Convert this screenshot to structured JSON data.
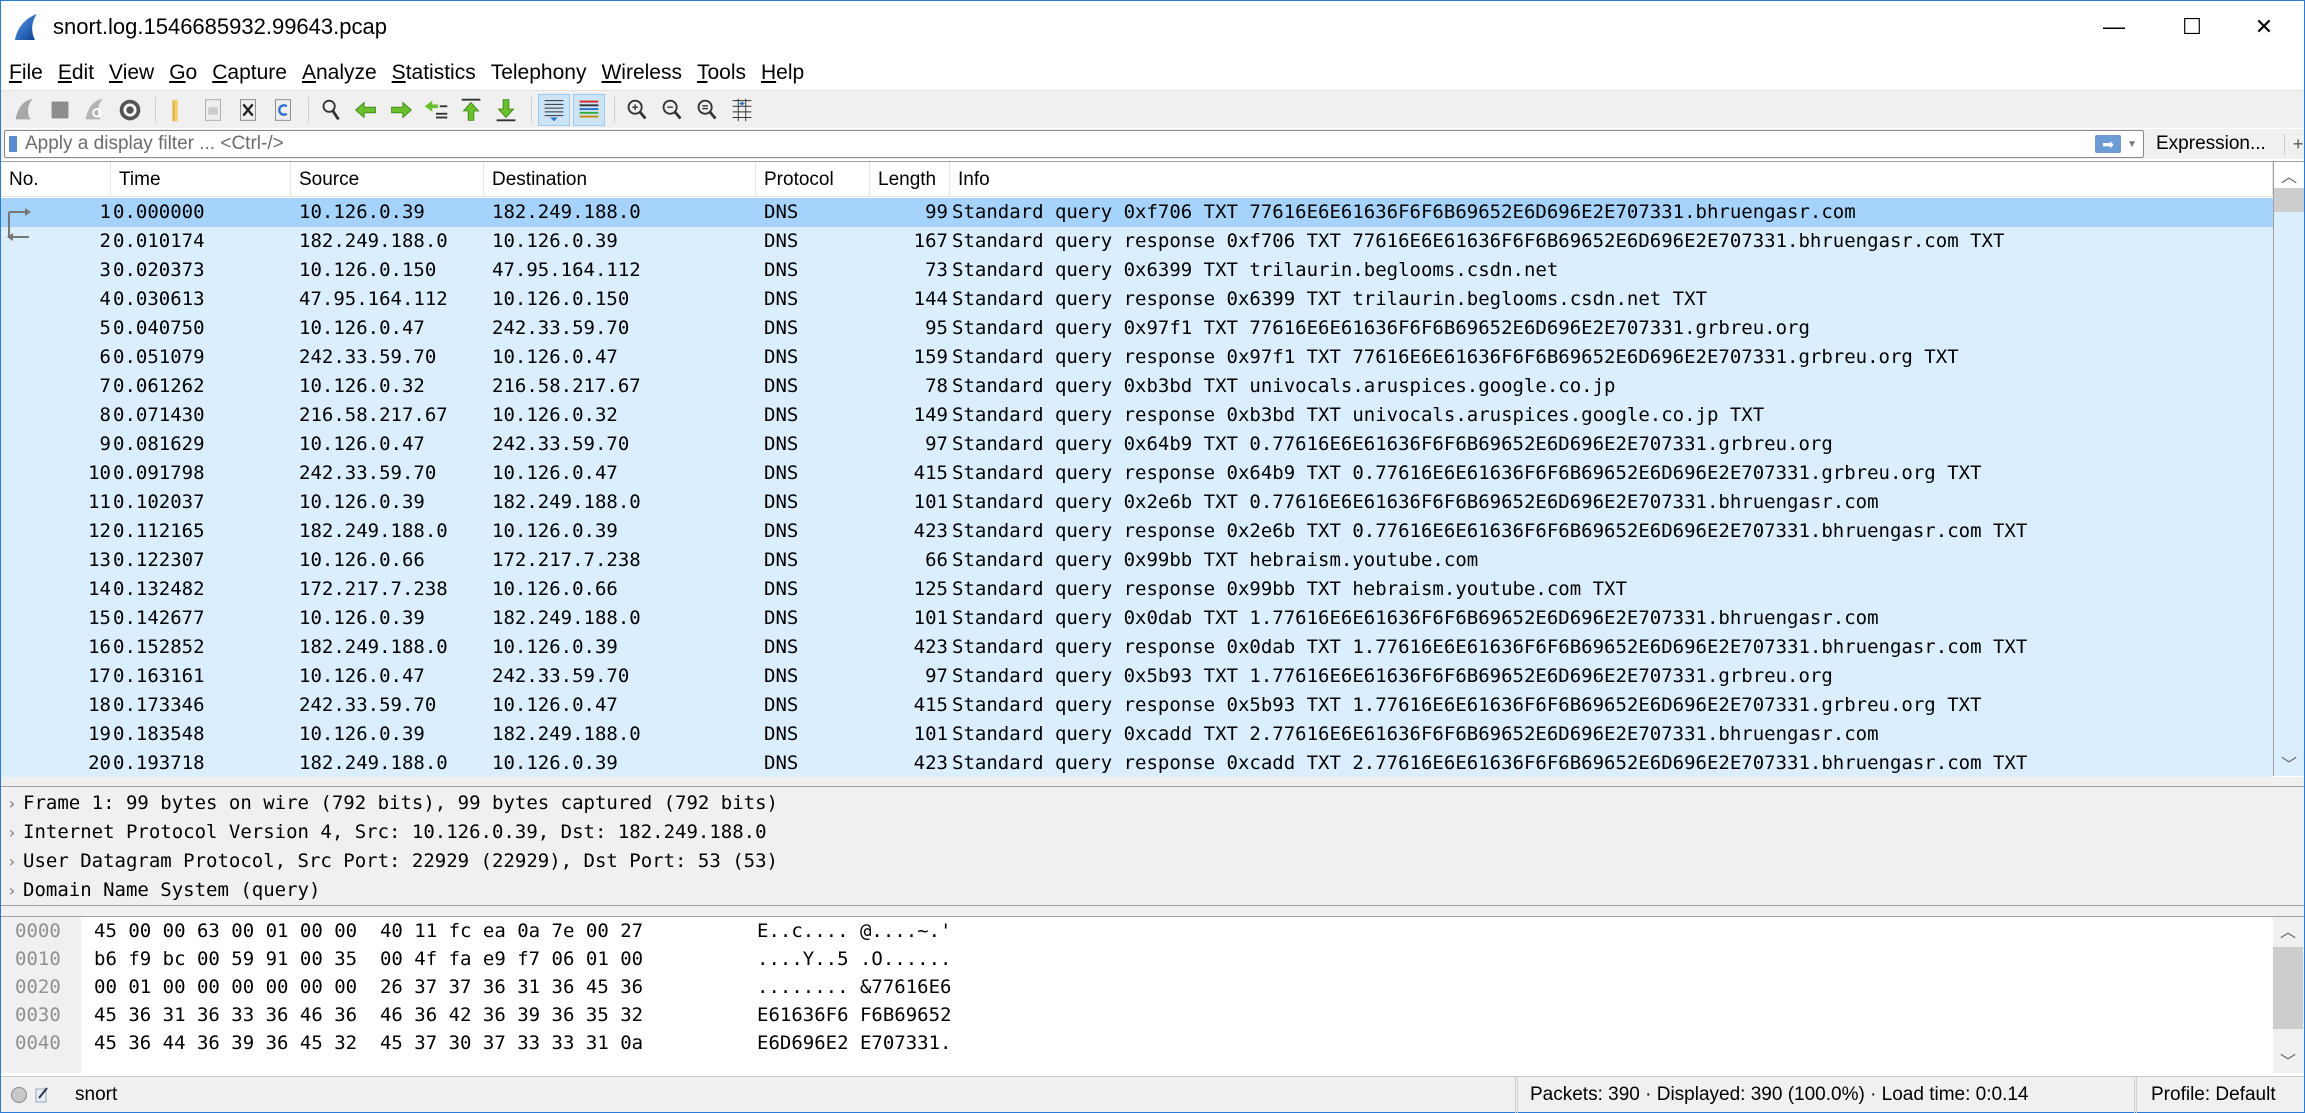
{
  "window": {
    "title": "snort.log.1546685932.99643.pcap",
    "controls": {
      "minimize": "—",
      "maximize": "☐",
      "close": "✕"
    }
  },
  "menu": [
    {
      "label": "File",
      "accel": "F",
      "rest": "ile"
    },
    {
      "label": "Edit",
      "accel": "E",
      "rest": "dit"
    },
    {
      "label": "View",
      "accel": "V",
      "rest": "iew"
    },
    {
      "label": "Go",
      "accel": "G",
      "rest": "o"
    },
    {
      "label": "Capture",
      "accel": "C",
      "rest": "apture"
    },
    {
      "label": "Analyze",
      "accel": "A",
      "rest": "nalyze"
    },
    {
      "label": "Statistics",
      "accel": "S",
      "rest": "tatistics"
    },
    {
      "label": "Telephony",
      "accel": "",
      "rest": "Telephony"
    },
    {
      "label": "Wireless",
      "accel": "W",
      "rest": "ireless"
    },
    {
      "label": "Tools",
      "accel": "T",
      "rest": "ools"
    },
    {
      "label": "Help",
      "accel": "H",
      "rest": "elp"
    }
  ],
  "toolbar": [
    {
      "name": "start-capture-icon"
    },
    {
      "name": "stop-capture-icon"
    },
    {
      "name": "restart-capture-icon"
    },
    {
      "name": "capture-options-icon"
    },
    {
      "name": "open-file-icon"
    },
    {
      "name": "save-file-icon"
    },
    {
      "name": "close-file-icon"
    },
    {
      "name": "reload-file-icon"
    },
    {
      "name": "find-packet-icon"
    },
    {
      "name": "go-back-icon"
    },
    {
      "name": "go-forward-icon"
    },
    {
      "name": "go-to-packet-icon"
    },
    {
      "name": "go-first-packet-icon"
    },
    {
      "name": "go-last-packet-icon"
    },
    {
      "name": "auto-scroll-icon",
      "active": true
    },
    {
      "name": "colorize-icon",
      "active": true
    },
    {
      "name": "zoom-in-icon"
    },
    {
      "name": "zoom-out-icon"
    },
    {
      "name": "zoom-normal-icon"
    },
    {
      "name": "resize-columns-icon"
    }
  ],
  "filter": {
    "placeholder": "Apply a display filter ... <Ctrl-/>",
    "value": "",
    "expression_label": "Expression...",
    "plus_label": "+"
  },
  "packet_list": {
    "columns": [
      "No.",
      "Time",
      "Source",
      "Destination",
      "Protocol",
      "Length",
      "Info"
    ],
    "selected_row": 1,
    "rows": [
      {
        "no": "1",
        "time": "0.000000",
        "src": "10.126.0.39",
        "dst": "182.249.188.0",
        "proto": "DNS",
        "len": "99",
        "info": "Standard query 0xf706 TXT 77616E6E61636F6F6B69652E6D696E2E707331.bhruengasr.com"
      },
      {
        "no": "2",
        "time": "0.010174",
        "src": "182.249.188.0",
        "dst": "10.126.0.39",
        "proto": "DNS",
        "len": "167",
        "info": "Standard query response 0xf706 TXT 77616E6E61636F6F6B69652E6D696E2E707331.bhruengasr.com TXT"
      },
      {
        "no": "3",
        "time": "0.020373",
        "src": "10.126.0.150",
        "dst": "47.95.164.112",
        "proto": "DNS",
        "len": "73",
        "info": "Standard query 0x6399 TXT trilaurin.beglooms.csdn.net"
      },
      {
        "no": "4",
        "time": "0.030613",
        "src": "47.95.164.112",
        "dst": "10.126.0.150",
        "proto": "DNS",
        "len": "144",
        "info": "Standard query response 0x6399 TXT trilaurin.beglooms.csdn.net TXT"
      },
      {
        "no": "5",
        "time": "0.040750",
        "src": "10.126.0.47",
        "dst": "242.33.59.70",
        "proto": "DNS",
        "len": "95",
        "info": "Standard query 0x97f1 TXT 77616E6E61636F6F6B69652E6D696E2E707331.grbreu.org"
      },
      {
        "no": "6",
        "time": "0.051079",
        "src": "242.33.59.70",
        "dst": "10.126.0.47",
        "proto": "DNS",
        "len": "159",
        "info": "Standard query response 0x97f1 TXT 77616E6E61636F6F6B69652E6D696E2E707331.grbreu.org TXT"
      },
      {
        "no": "7",
        "time": "0.061262",
        "src": "10.126.0.32",
        "dst": "216.58.217.67",
        "proto": "DNS",
        "len": "78",
        "info": "Standard query 0xb3bd TXT univocals.aruspices.google.co.jp"
      },
      {
        "no": "8",
        "time": "0.071430",
        "src": "216.58.217.67",
        "dst": "10.126.0.32",
        "proto": "DNS",
        "len": "149",
        "info": "Standard query response 0xb3bd TXT univocals.aruspices.google.co.jp TXT"
      },
      {
        "no": "9",
        "time": "0.081629",
        "src": "10.126.0.47",
        "dst": "242.33.59.70",
        "proto": "DNS",
        "len": "97",
        "info": "Standard query 0x64b9 TXT 0.77616E6E61636F6F6B69652E6D696E2E707331.grbreu.org"
      },
      {
        "no": "10",
        "time": "0.091798",
        "src": "242.33.59.70",
        "dst": "10.126.0.47",
        "proto": "DNS",
        "len": "415",
        "info": "Standard query response 0x64b9 TXT 0.77616E6E61636F6F6B69652E6D696E2E707331.grbreu.org TXT"
      },
      {
        "no": "11",
        "time": "0.102037",
        "src": "10.126.0.39",
        "dst": "182.249.188.0",
        "proto": "DNS",
        "len": "101",
        "info": "Standard query 0x2e6b TXT 0.77616E6E61636F6F6B69652E6D696E2E707331.bhruengasr.com"
      },
      {
        "no": "12",
        "time": "0.112165",
        "src": "182.249.188.0",
        "dst": "10.126.0.39",
        "proto": "DNS",
        "len": "423",
        "info": "Standard query response 0x2e6b TXT 0.77616E6E61636F6F6B69652E6D696E2E707331.bhruengasr.com TXT"
      },
      {
        "no": "13",
        "time": "0.122307",
        "src": "10.126.0.66",
        "dst": "172.217.7.238",
        "proto": "DNS",
        "len": "66",
        "info": "Standard query 0x99bb TXT hebraism.youtube.com"
      },
      {
        "no": "14",
        "time": "0.132482",
        "src": "172.217.7.238",
        "dst": "10.126.0.66",
        "proto": "DNS",
        "len": "125",
        "info": "Standard query response 0x99bb TXT hebraism.youtube.com TXT"
      },
      {
        "no": "15",
        "time": "0.142677",
        "src": "10.126.0.39",
        "dst": "182.249.188.0",
        "proto": "DNS",
        "len": "101",
        "info": "Standard query 0x0dab TXT 1.77616E6E61636F6F6B69652E6D696E2E707331.bhruengasr.com"
      },
      {
        "no": "16",
        "time": "0.152852",
        "src": "182.249.188.0",
        "dst": "10.126.0.39",
        "proto": "DNS",
        "len": "423",
        "info": "Standard query response 0x0dab TXT 1.77616E6E61636F6F6B69652E6D696E2E707331.bhruengasr.com TXT"
      },
      {
        "no": "17",
        "time": "0.163161",
        "src": "10.126.0.47",
        "dst": "242.33.59.70",
        "proto": "DNS",
        "len": "97",
        "info": "Standard query 0x5b93 TXT 1.77616E6E61636F6F6B69652E6D696E2E707331.grbreu.org"
      },
      {
        "no": "18",
        "time": "0.173346",
        "src": "242.33.59.70",
        "dst": "10.126.0.47",
        "proto": "DNS",
        "len": "415",
        "info": "Standard query response 0x5b93 TXT 1.77616E6E61636F6F6B69652E6D696E2E707331.grbreu.org TXT"
      },
      {
        "no": "19",
        "time": "0.183548",
        "src": "10.126.0.39",
        "dst": "182.249.188.0",
        "proto": "DNS",
        "len": "101",
        "info": "Standard query 0xcadd TXT 2.77616E6E61636F6F6B69652E6D696E2E707331.bhruengasr.com"
      },
      {
        "no": "20",
        "time": "0.193718",
        "src": "182.249.188.0",
        "dst": "10.126.0.39",
        "proto": "DNS",
        "len": "423",
        "info": "Standard query response 0xcadd TXT 2.77616E6E61636F6F6B69652E6D696E2E707331.bhruengasr.com TXT"
      }
    ]
  },
  "details": [
    "Frame 1: 99 bytes on wire (792 bits), 99 bytes captured (792 bits)",
    "Internet Protocol Version 4, Src: 10.126.0.39, Dst: 182.249.188.0",
    "User Datagram Protocol, Src Port: 22929 (22929), Dst Port: 53 (53)",
    "Domain Name System (query)"
  ],
  "hex": [
    {
      "offset": "0000",
      "bytes": "45 00 00 63 00 01 00 00  40 11 fc ea 0a 7e 00 27",
      "ascii": "E..c.... @....~.'"
    },
    {
      "offset": "0010",
      "bytes": "b6 f9 bc 00 59 91 00 35  00 4f fa e9 f7 06 01 00",
      "ascii": "....Y..5 .O......"
    },
    {
      "offset": "0020",
      "bytes": "00 01 00 00 00 00 00 00  26 37 37 36 31 36 45 36",
      "ascii": "........ &77616E6"
    },
    {
      "offset": "0030",
      "bytes": "45 36 31 36 33 36 46 36  46 36 42 36 39 36 35 32",
      "ascii": "E61636F6 F6B69652"
    },
    {
      "offset": "0040",
      "bytes": "45 36 44 36 39 36 45 32  45 37 30 37 33 33 31 0a",
      "ascii": "E6D696E2 E707331."
    }
  ],
  "status": {
    "profile_name": "snort",
    "stats": "Packets: 390 · Displayed: 390 (100.0%) ·  Load time: 0:0.14",
    "profile": "Profile: Default"
  },
  "colors": {
    "row_bg": "#daeefe",
    "row_selected": "#a6d3fb",
    "window_border": "#2b79d6"
  }
}
